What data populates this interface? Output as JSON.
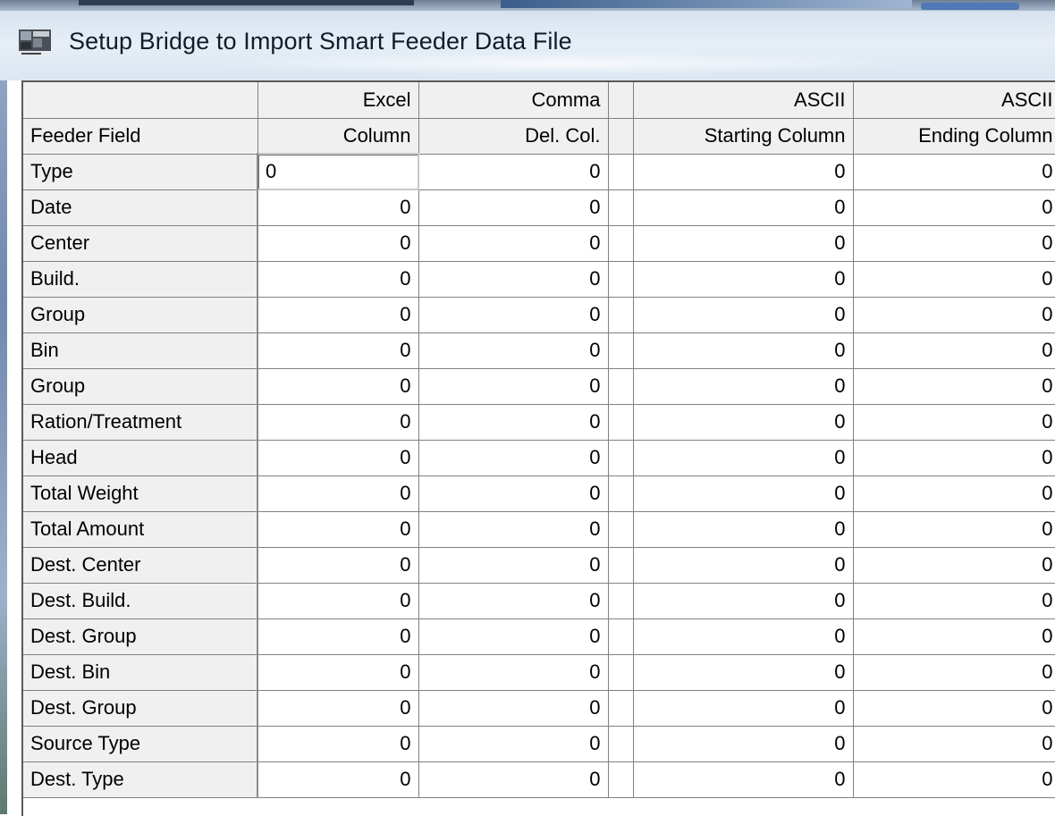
{
  "window": {
    "title": "Setup Bridge to Import Smart Feeder Data File",
    "icon": "app-logo-icon"
  },
  "grid": {
    "header_row1": [
      "",
      "Excel",
      "Comma",
      "",
      "ASCII",
      "ASCII"
    ],
    "header_row2": [
      "Feeder Field",
      "Column",
      "Del. Col.",
      "",
      "Starting Column",
      "Ending Column"
    ],
    "rows": [
      {
        "field": "Type",
        "excel": "0",
        "comma": "0",
        "ascii_start": "0",
        "ascii_end": "0"
      },
      {
        "field": "Date",
        "excel": "0",
        "comma": "0",
        "ascii_start": "0",
        "ascii_end": "0"
      },
      {
        "field": "Center",
        "excel": "0",
        "comma": "0",
        "ascii_start": "0",
        "ascii_end": "0"
      },
      {
        "field": "Build.",
        "excel": "0",
        "comma": "0",
        "ascii_start": "0",
        "ascii_end": "0"
      },
      {
        "field": "Group",
        "excel": "0",
        "comma": "0",
        "ascii_start": "0",
        "ascii_end": "0"
      },
      {
        "field": "Bin",
        "excel": "0",
        "comma": "0",
        "ascii_start": "0",
        "ascii_end": "0"
      },
      {
        "field": "Group",
        "excel": "0",
        "comma": "0",
        "ascii_start": "0",
        "ascii_end": "0"
      },
      {
        "field": "Ration/Treatment",
        "excel": "0",
        "comma": "0",
        "ascii_start": "0",
        "ascii_end": "0"
      },
      {
        "field": "Head",
        "excel": "0",
        "comma": "0",
        "ascii_start": "0",
        "ascii_end": "0"
      },
      {
        "field": "Total Weight",
        "excel": "0",
        "comma": "0",
        "ascii_start": "0",
        "ascii_end": "0"
      },
      {
        "field": "Total Amount",
        "excel": "0",
        "comma": "0",
        "ascii_start": "0",
        "ascii_end": "0"
      },
      {
        "field": "Dest. Center",
        "excel": "0",
        "comma": "0",
        "ascii_start": "0",
        "ascii_end": "0"
      },
      {
        "field": "Dest. Build.",
        "excel": "0",
        "comma": "0",
        "ascii_start": "0",
        "ascii_end": "0"
      },
      {
        "field": "Dest. Group",
        "excel": "0",
        "comma": "0",
        "ascii_start": "0",
        "ascii_end": "0"
      },
      {
        "field": "Dest. Bin",
        "excel": "0",
        "comma": "0",
        "ascii_start": "0",
        "ascii_end": "0"
      },
      {
        "field": "Dest. Group",
        "excel": "0",
        "comma": "0",
        "ascii_start": "0",
        "ascii_end": "0"
      },
      {
        "field": "Source Type",
        "excel": "0",
        "comma": "0",
        "ascii_start": "0",
        "ascii_end": "0"
      },
      {
        "field": "Dest. Type",
        "excel": "0",
        "comma": "0",
        "ascii_start": "0",
        "ascii_end": "0"
      }
    ]
  }
}
